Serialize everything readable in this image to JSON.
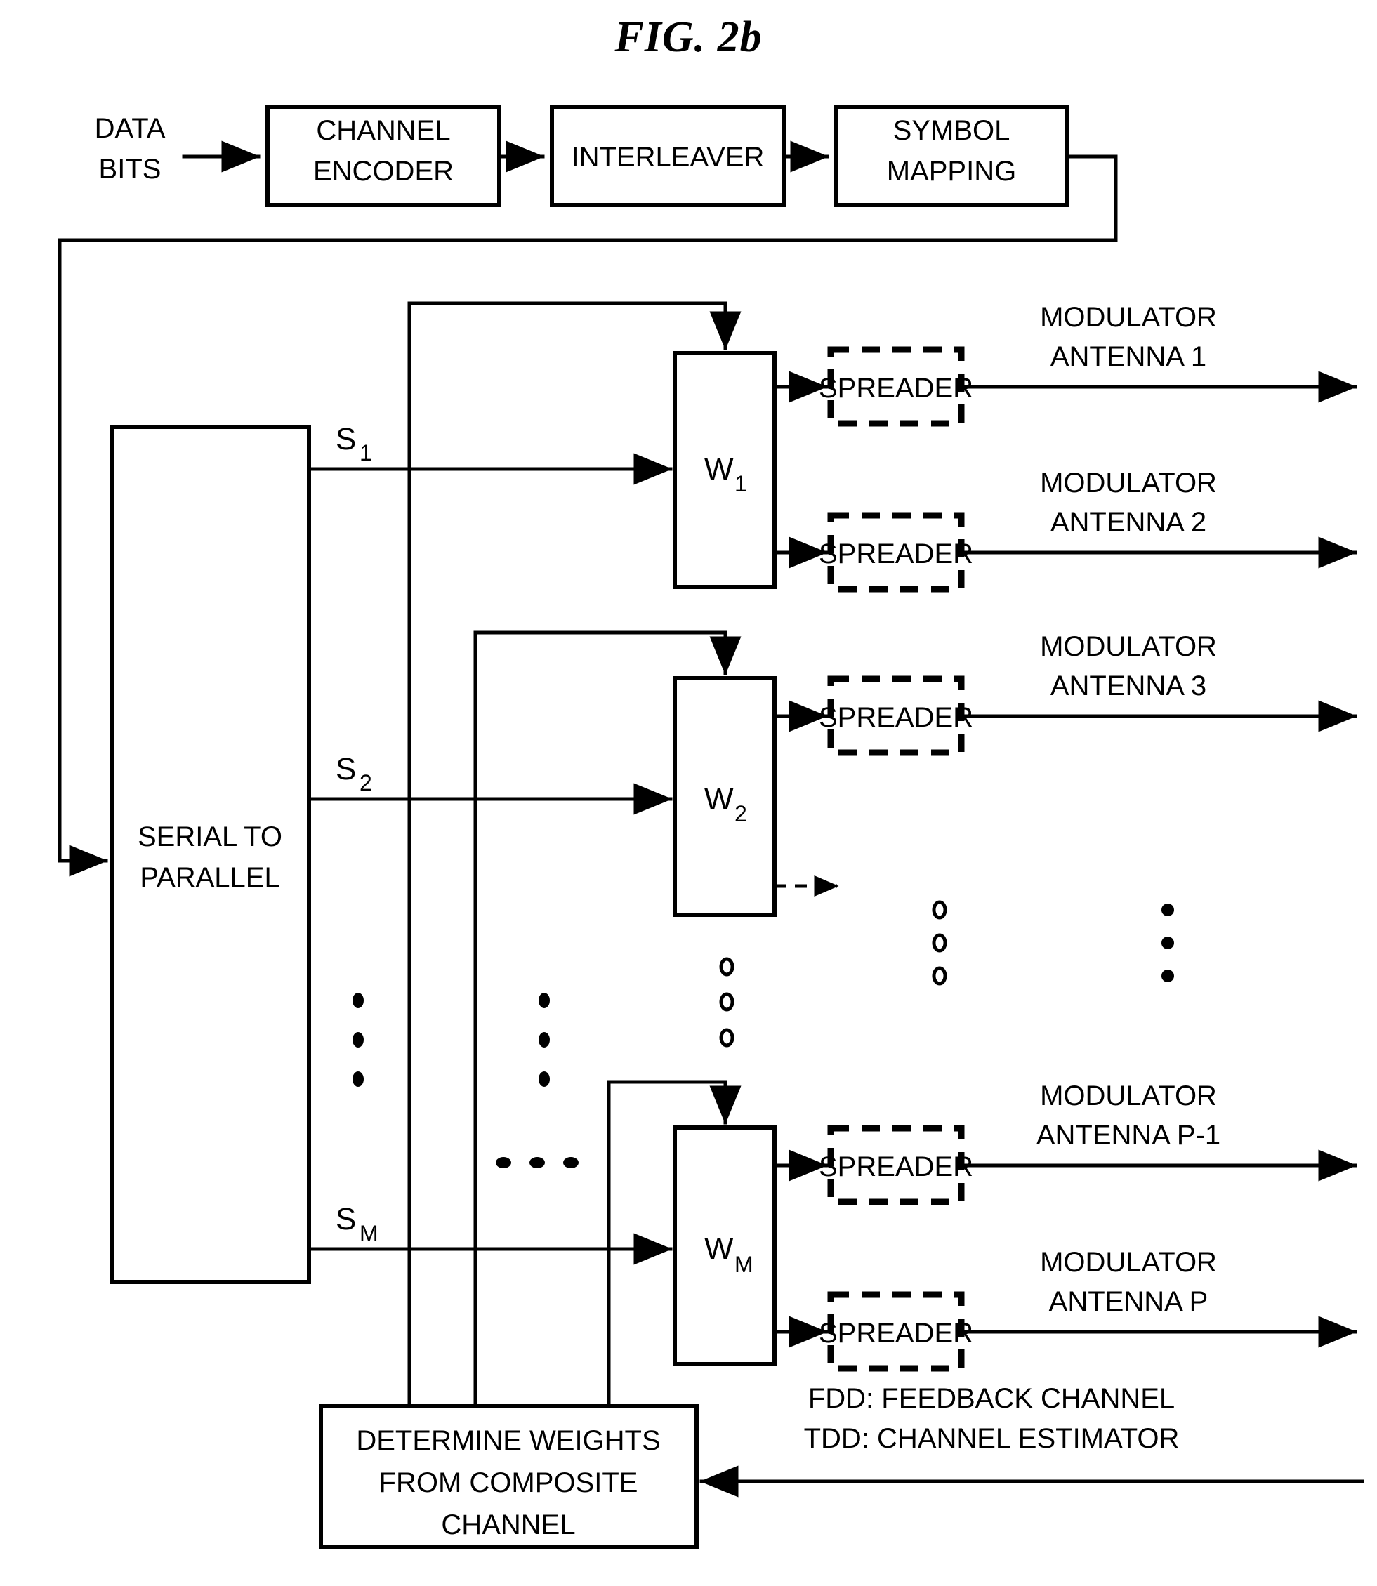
{
  "figure": {
    "title": "FIG. 2b",
    "type": "block-diagram",
    "caption_notes": [
      "FDD: FEEDBACK CHANNEL",
      "TDD: CHANNEL ESTIMATOR"
    ]
  },
  "labels": {
    "data_bits_line1": "DATA",
    "data_bits_line2": "BITS",
    "channel_encoder_line1": "CHANNEL",
    "channel_encoder_line2": "ENCODER",
    "interleaver": "INTERLEAVER",
    "symbol_mapping_line1": "SYMBOL",
    "symbol_mapping_line2": "MAPPING",
    "serial_to_parallel_line1": "SERIAL TO",
    "serial_to_parallel_line2": "PARALLEL",
    "determine_weights_line1": "DETERMINE WEIGHTS",
    "determine_weights_line2": "FROM COMPOSITE",
    "determine_weights_line3": "CHANNEL",
    "spreader": "SPREADER",
    "fdd_note": "FDD: FEEDBACK CHANNEL",
    "tdd_note": "TDD: CHANNEL ESTIMATOR"
  },
  "signals": [
    {
      "base": "S",
      "index": "1"
    },
    {
      "base": "S",
      "index": "2"
    },
    {
      "base": "S",
      "index": "M"
    }
  ],
  "weights": [
    {
      "base": "W",
      "index": "1"
    },
    {
      "base": "W",
      "index": "2"
    },
    {
      "base": "W",
      "index": "M"
    }
  ],
  "spreaders": [
    {
      "label": "SPREADER",
      "output_line1": "MODULATOR",
      "output_line2": "ANTENNA 1"
    },
    {
      "label": "SPREADER",
      "output_line1": "MODULATOR",
      "output_line2": "ANTENNA 2"
    },
    {
      "label": "SPREADER",
      "output_line1": "MODULATOR",
      "output_line2": "ANTENNA 3"
    },
    {
      "label": "SPREADER",
      "output_line1": "MODULATOR",
      "output_line2": "ANTENNA P-1"
    },
    {
      "label": "SPREADER",
      "output_line1": "MODULATOR",
      "output_line2": "ANTENNA P"
    }
  ],
  "outputs": {
    "antenna_1_line1": "MODULATOR",
    "antenna_1_line2": "ANTENNA 1",
    "antenna_2_line1": "MODULATOR",
    "antenna_2_line2": "ANTENNA 2",
    "antenna_3_line1": "MODULATOR",
    "antenna_3_line2": "ANTENNA 3",
    "antenna_pm1_line1": "MODULATOR",
    "antenna_pm1_line2": "ANTENNA P-1",
    "antenna_p_line1": "MODULATOR",
    "antenna_p_line2": "ANTENNA P"
  },
  "colors": {
    "ink": "#000000",
    "paper": "#ffffff"
  }
}
